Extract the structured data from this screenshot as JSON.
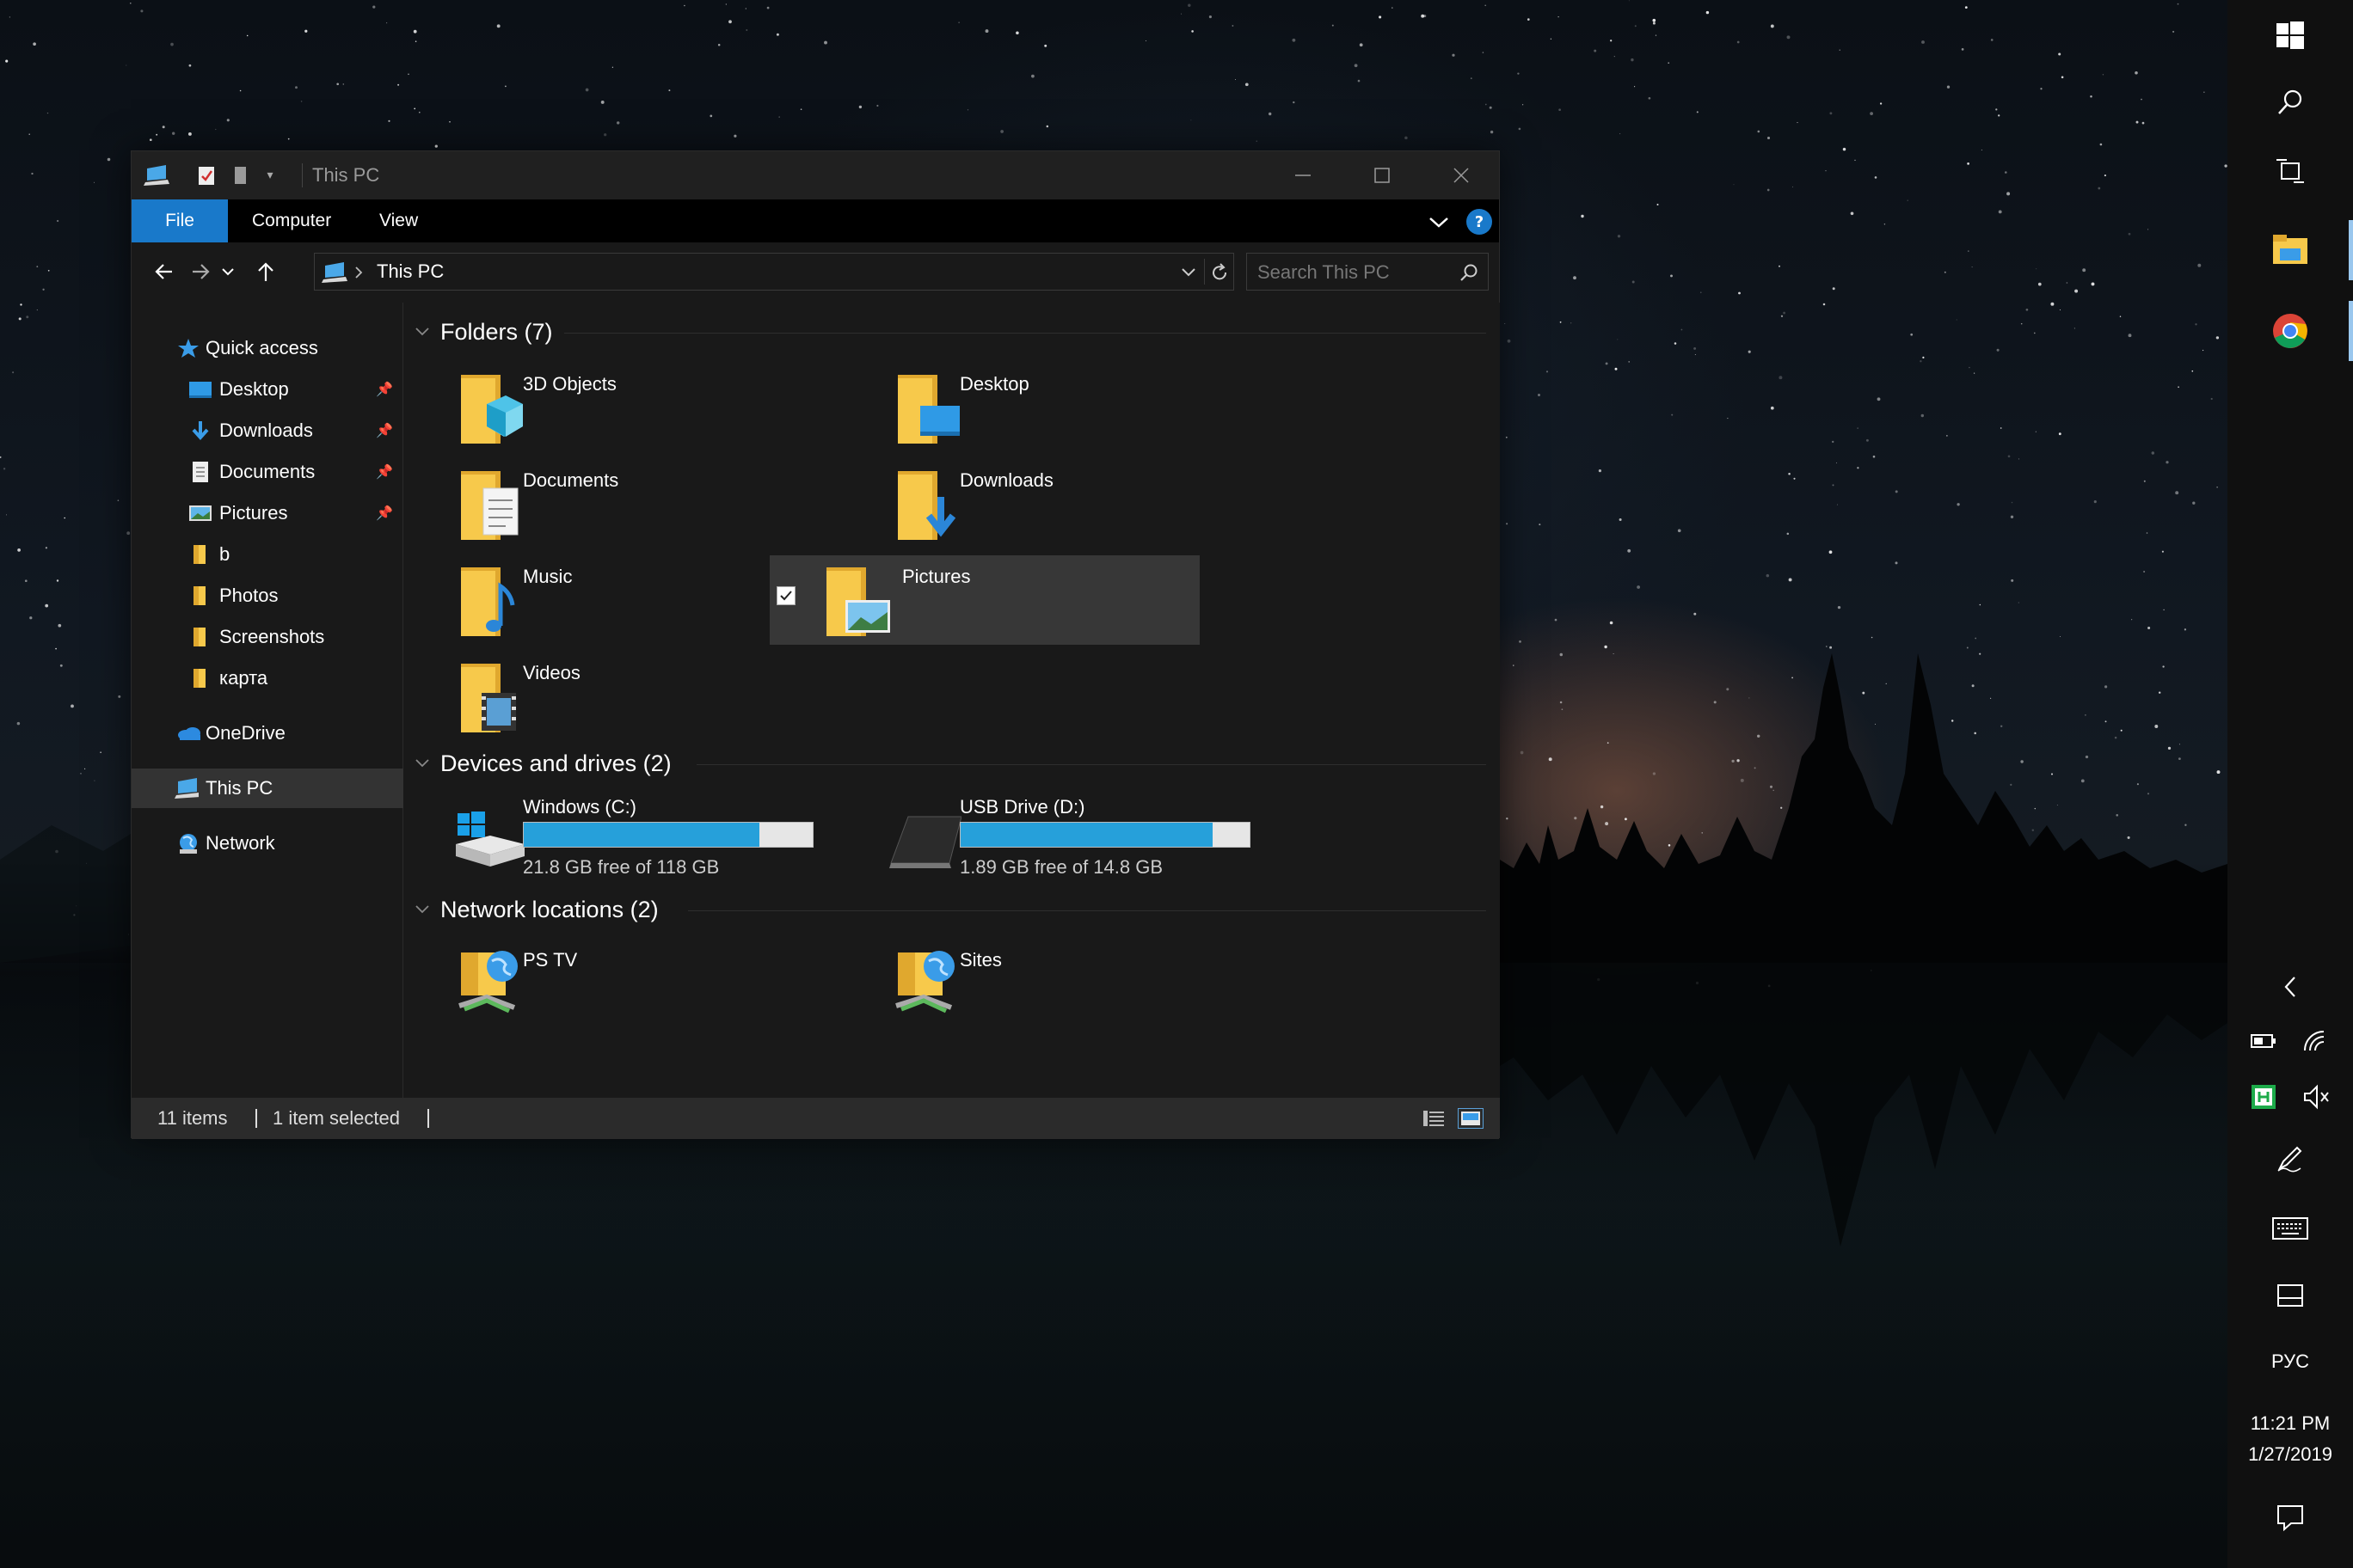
{
  "window": {
    "title": "This PC",
    "ribbon_tabs": [
      "File",
      "Computer",
      "View"
    ],
    "address": "This PC",
    "search_placeholder": "Search This PC",
    "help_label": "?"
  },
  "navigation": {
    "quick_access": "Quick access",
    "quick_items": [
      {
        "label": "Desktop",
        "pinned": true
      },
      {
        "label": "Downloads",
        "pinned": true
      },
      {
        "label": "Documents",
        "pinned": true
      },
      {
        "label": "Pictures",
        "pinned": true
      },
      {
        "label": "b",
        "pinned": false
      },
      {
        "label": "Photos",
        "pinned": false
      },
      {
        "label": "Screenshots",
        "pinned": false
      },
      {
        "label": "карта",
        "pinned": false
      }
    ],
    "onedrive": "OneDrive",
    "this_pc": "This PC",
    "network": "Network"
  },
  "content": {
    "folders_header": "Folders (7)",
    "folders": [
      "3D Objects",
      "Desktop",
      "Documents",
      "Downloads",
      "Music",
      "Pictures",
      "Videos"
    ],
    "selected_folder": "Pictures",
    "devices_header": "Devices and drives (2)",
    "drives": [
      {
        "name": "Windows (C:)",
        "free": "21.8 GB free of 118 GB",
        "used_fraction": 0.815
      },
      {
        "name": "USB Drive (D:)",
        "free": "1.89 GB free of 14.8 GB",
        "used_fraction": 0.872
      }
    ],
    "network_header": "Network locations (2)",
    "network_locations": [
      "PS TV",
      "Sites"
    ]
  },
  "status": {
    "item_count": "11 items",
    "selected": "1 item selected"
  },
  "taskbar": {
    "language": "РУС",
    "time": "11:21 PM",
    "date": "1/27/2019"
  },
  "colors": {
    "accent": "#1979ca",
    "drive_fill": "#26a0da",
    "window_bg": "#191919",
    "folder_yellow": "#f7c94b"
  }
}
